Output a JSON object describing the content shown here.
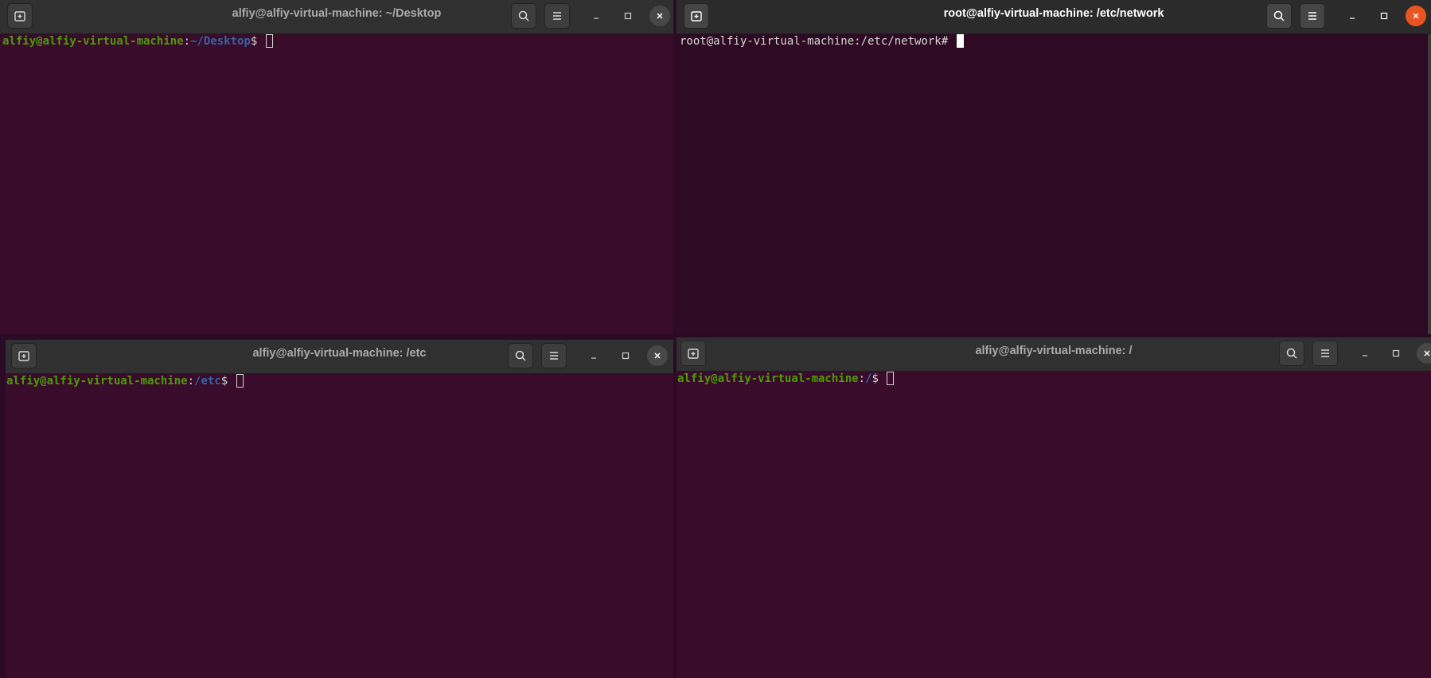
{
  "windows": [
    {
      "title": "alfiy@alfiy-virtual-machine: ~/Desktop",
      "prompt": {
        "user": "alfiy@alfiy-virtual-machine",
        "sep": ":",
        "path": "~/Desktop",
        "symbol": "$ "
      }
    },
    {
      "title": "root@alfiy-virtual-machine: /etc/network",
      "prompt": {
        "text": "root@alfiy-virtual-machine:/etc/network# "
      }
    },
    {
      "title": "alfiy@alfiy-virtual-machine: /etc",
      "prompt": {
        "user": "alfiy@alfiy-virtual-machine",
        "sep": ":",
        "path": "/etc",
        "symbol": "$ "
      }
    },
    {
      "title": "alfiy@alfiy-virtual-machine: /",
      "prompt": {
        "user": "alfiy@alfiy-virtual-machine",
        "sep": ":",
        "path": "/",
        "symbol": "$ "
      }
    }
  ],
  "icons": {
    "new_tab": "new-tab-icon",
    "search": "search-icon",
    "menu": "hamburger-menu-icon",
    "minimize": "minimize-icon",
    "maximize": "maximize-icon",
    "close": "close-icon"
  },
  "colors": {
    "terminal_bg": "#380c2a",
    "prompt_user": "#4e9a06",
    "prompt_path": "#3465a4",
    "close_active": "#e95420"
  },
  "focused_window": 1
}
